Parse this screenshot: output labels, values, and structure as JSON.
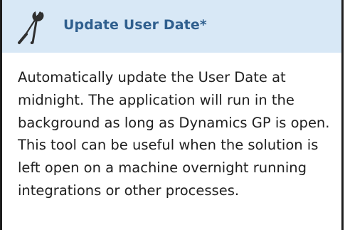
{
  "tool_panel": {
    "icon": "wrench-screwdriver-icon",
    "title": "Update User Date*",
    "description": "Automatically update the User Date at midnight. The application will run in the background as long as Dynamics GP is open. This tool can be useful when the solution is left open on a machine overnight running integrations or other processes.",
    "colors": {
      "header_bg": "#d8e8f6",
      "title_text": "#2f5f8e",
      "border": "#1d1d1d",
      "body_text": "#202020"
    }
  }
}
